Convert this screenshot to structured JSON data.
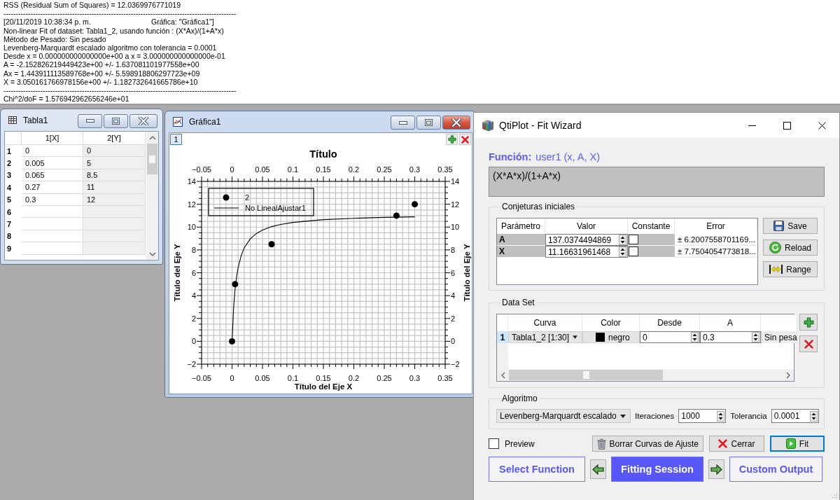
{
  "log": {
    "lines": [
      {
        "text": "RSS (Residual Sum of Squares) = 12.0369976771019"
      },
      {
        "text": "-----------------------------------------------------------------------------------------------"
      },
      {
        "text": "[20/11/2019 10:38:34 p. m.",
        "aside": "Gráfica: \"Gráfica1\"]"
      },
      {
        "text": "Non-linear Fit of dataset: Tabla1_2, usando función : (X*Ax)/(1+A*x)"
      },
      {
        "text": "Método de Pesado: Sin pesado"
      },
      {
        "text": "Levenberg-Marquardt escalado algoritmo con tolerancia = 0.0001"
      },
      {
        "text": "Desde x = 0.000000000000000e+00 a x = 3.000000000000000e-01"
      },
      {
        "text": "A = -2.152826219449423e+00 +/- 1.637081101977558e+00"
      },
      {
        "text": "Ax = 1.443911113589768e+00 +/- 5.598918806297723e+09"
      },
      {
        "text": "X = 3.050161766978156e+00 +/- 1.182732641665786e+10"
      },
      {
        "text": "-----------------------------------------------------------------------------------------------"
      },
      {
        "text": "Chi^2/doF = 1.576942962656246e+01"
      }
    ]
  },
  "table_window": {
    "title": "Tabla1",
    "active": false,
    "columns": [
      "1[X]",
      "2[Y]"
    ],
    "rows": [
      {
        "number": "1",
        "cells": [
          "0",
          "0"
        ]
      },
      {
        "number": "2",
        "cells": [
          "0.005",
          "5"
        ]
      },
      {
        "number": "3",
        "cells": [
          "0.065",
          "8.5"
        ]
      },
      {
        "number": "4",
        "cells": [
          "0.27",
          "11"
        ]
      },
      {
        "number": "5",
        "cells": [
          "0.3",
          "12"
        ]
      },
      {
        "number": "6"
      },
      {
        "number": "7"
      },
      {
        "number": "8"
      },
      {
        "number": "9"
      }
    ]
  },
  "plot_window": {
    "title": "Gráfica1",
    "active": true,
    "layer": "1",
    "top_axis": {
      "labels": [
        "−0.05",
        "0",
        "0.05",
        "0.1",
        "0.15",
        "0.2",
        "0.25",
        "0.3",
        "0.35"
      ]
    },
    "right_axis": {
      "title": "Título del Eje Y",
      "labels": [
        "14",
        "12",
        "10",
        "8",
        "6",
        "4",
        "2",
        "0",
        "−2"
      ]
    },
    "chart_data": {
      "type": "scatter",
      "title": "Título",
      "xlabel": "Título del Eje X",
      "ylabel": "Título del Eje Y",
      "grid": true,
      "legend": "upper left",
      "x": [
        0,
        0.0025,
        0.005,
        0.0075,
        0.01,
        0.015,
        0.02,
        0.03,
        0.04,
        0.05,
        0.065,
        0.08,
        0.1,
        0.15,
        0.2,
        0.25,
        0.27,
        0.3
      ],
      "series": [
        {
          "name": "2",
          "type": "scatter",
          "color": "#000000",
          "values": [
            0,
            null,
            5,
            null,
            null,
            null,
            null,
            null,
            null,
            null,
            8.5,
            null,
            null,
            null,
            null,
            null,
            11,
            12
          ]
        },
        {
          "name": "No LinealAjustar1",
          "type": "line",
          "color": "#000000",
          "values": [
            0,
            2.85,
            4.54,
            5.66,
            6.46,
            7.51,
            8.18,
            8.98,
            9.44,
            9.74,
            10.04,
            10.23,
            10.41,
            10.65,
            10.77,
            10.85,
            10.87,
            10.9
          ]
        }
      ],
      "xlim": [
        -0.05,
        0.35
      ],
      "ylim": [
        -2,
        14
      ],
      "xticks": [
        {
          "value": -0.05,
          "label": "−0.05"
        },
        {
          "value": 0,
          "label": "0"
        },
        {
          "value": 0.05,
          "label": "0.05"
        },
        {
          "value": 0.1,
          "label": "0.1"
        },
        {
          "value": 0.15,
          "label": "0.15"
        },
        {
          "value": 0.2,
          "label": "0.2"
        },
        {
          "value": 0.25,
          "label": "0.25"
        },
        {
          "value": 0.3,
          "label": "0.3"
        },
        {
          "value": 0.35,
          "label": "0.35"
        }
      ],
      "yticks": [
        {
          "value": -2,
          "label": "−2"
        },
        {
          "value": 0,
          "label": "0"
        },
        {
          "value": 2,
          "label": "2"
        },
        {
          "value": 4,
          "label": "4"
        },
        {
          "value": 6,
          "label": "6"
        },
        {
          "value": 8,
          "label": "8"
        },
        {
          "value": 10,
          "label": "10"
        },
        {
          "value": 12,
          "label": "12"
        },
        {
          "value": 14,
          "label": "14"
        }
      ]
    }
  },
  "fit_wizard": {
    "title": "QtiPlot - Fit Wizard",
    "function_label": "Función:",
    "function_signature": "user1 (x, A, X)",
    "formula": "(X*A*x)/(1+A*x)",
    "initial_guesses": {
      "title": "Conjeturas iniciales",
      "columns": [
        "Parámetro",
        "Valor",
        "Constante",
        "Error"
      ],
      "rows": [
        {
          "name": "A",
          "value": "137.0374494869",
          "constant": false,
          "error": "± 6.2007558701169..."
        },
        {
          "name": "X",
          "value": "11.16631961468",
          "constant": false,
          "error": "± 7.7504054773818..."
        }
      ],
      "buttons": [
        {
          "label": "Save",
          "kind": "save"
        },
        {
          "label": "Reload",
          "kind": "reload"
        },
        {
          "label": "Range",
          "kind": "range"
        }
      ]
    },
    "data_set": {
      "title": "Data Set",
      "columns": [
        "Curva",
        "Color",
        "Desde",
        "A"
      ],
      "rows": [
        {
          "number": "1",
          "curve": "Tabla1_2 [1:30]",
          "color": "#000000",
          "color_name": "negro",
          "from": "0",
          "to": "0.3",
          "weighting": "Sin pesa"
        }
      ]
    },
    "algorithm": {
      "title": "Algoritmo",
      "method": "Levenberg-Marquardt escalado",
      "iterations_label": "Iteraciones",
      "iterations": "1000",
      "tolerance_label": "Tolerancia",
      "tolerance": "0.0001"
    },
    "preview": {
      "label": "Preview",
      "checked": false
    },
    "actions": [
      {
        "label": "Borrar Curvas de Ajuste",
        "kind": "clear",
        "focused": false
      },
      {
        "label": "Cerrar",
        "kind": "close",
        "focused": false
      },
      {
        "label": "Fit",
        "kind": "fit",
        "focused": true
      }
    ],
    "pages": [
      {
        "label": "Select Function",
        "selected": false
      },
      {
        "label": "Fitting Session",
        "selected": true
      },
      {
        "label": "Custom Output",
        "selected": false
      }
    ]
  }
}
